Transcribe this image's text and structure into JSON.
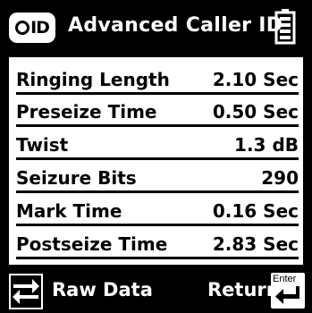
{
  "header": {
    "badge_text": "ID",
    "title": "Advanced Caller ID"
  },
  "rows": [
    {
      "label": "Ringing Length",
      "value": "2.10 Sec"
    },
    {
      "label": "Preseize Time",
      "value": "0.50 Sec"
    },
    {
      "label": "Twist",
      "value": "1.3 dB"
    },
    {
      "label": "Seizure Bits",
      "value": "290"
    },
    {
      "label": "Mark Time",
      "value": "0.16 Sec"
    },
    {
      "label": "Postseize Time",
      "value": "2.83 Sec"
    }
  ],
  "footer": {
    "raw_data_label": "Raw Data",
    "return_label": "Return",
    "enter_key_label": "Enter"
  },
  "icons": {
    "badge": "caller-id-icon",
    "battery": "battery-icon",
    "swap": "swap-arrows-icon",
    "enter": "enter-key-icon"
  },
  "colors": {
    "background": "#000000",
    "panel": "#ffffff",
    "text_dark": "#000000",
    "text_light": "#ffffff"
  }
}
